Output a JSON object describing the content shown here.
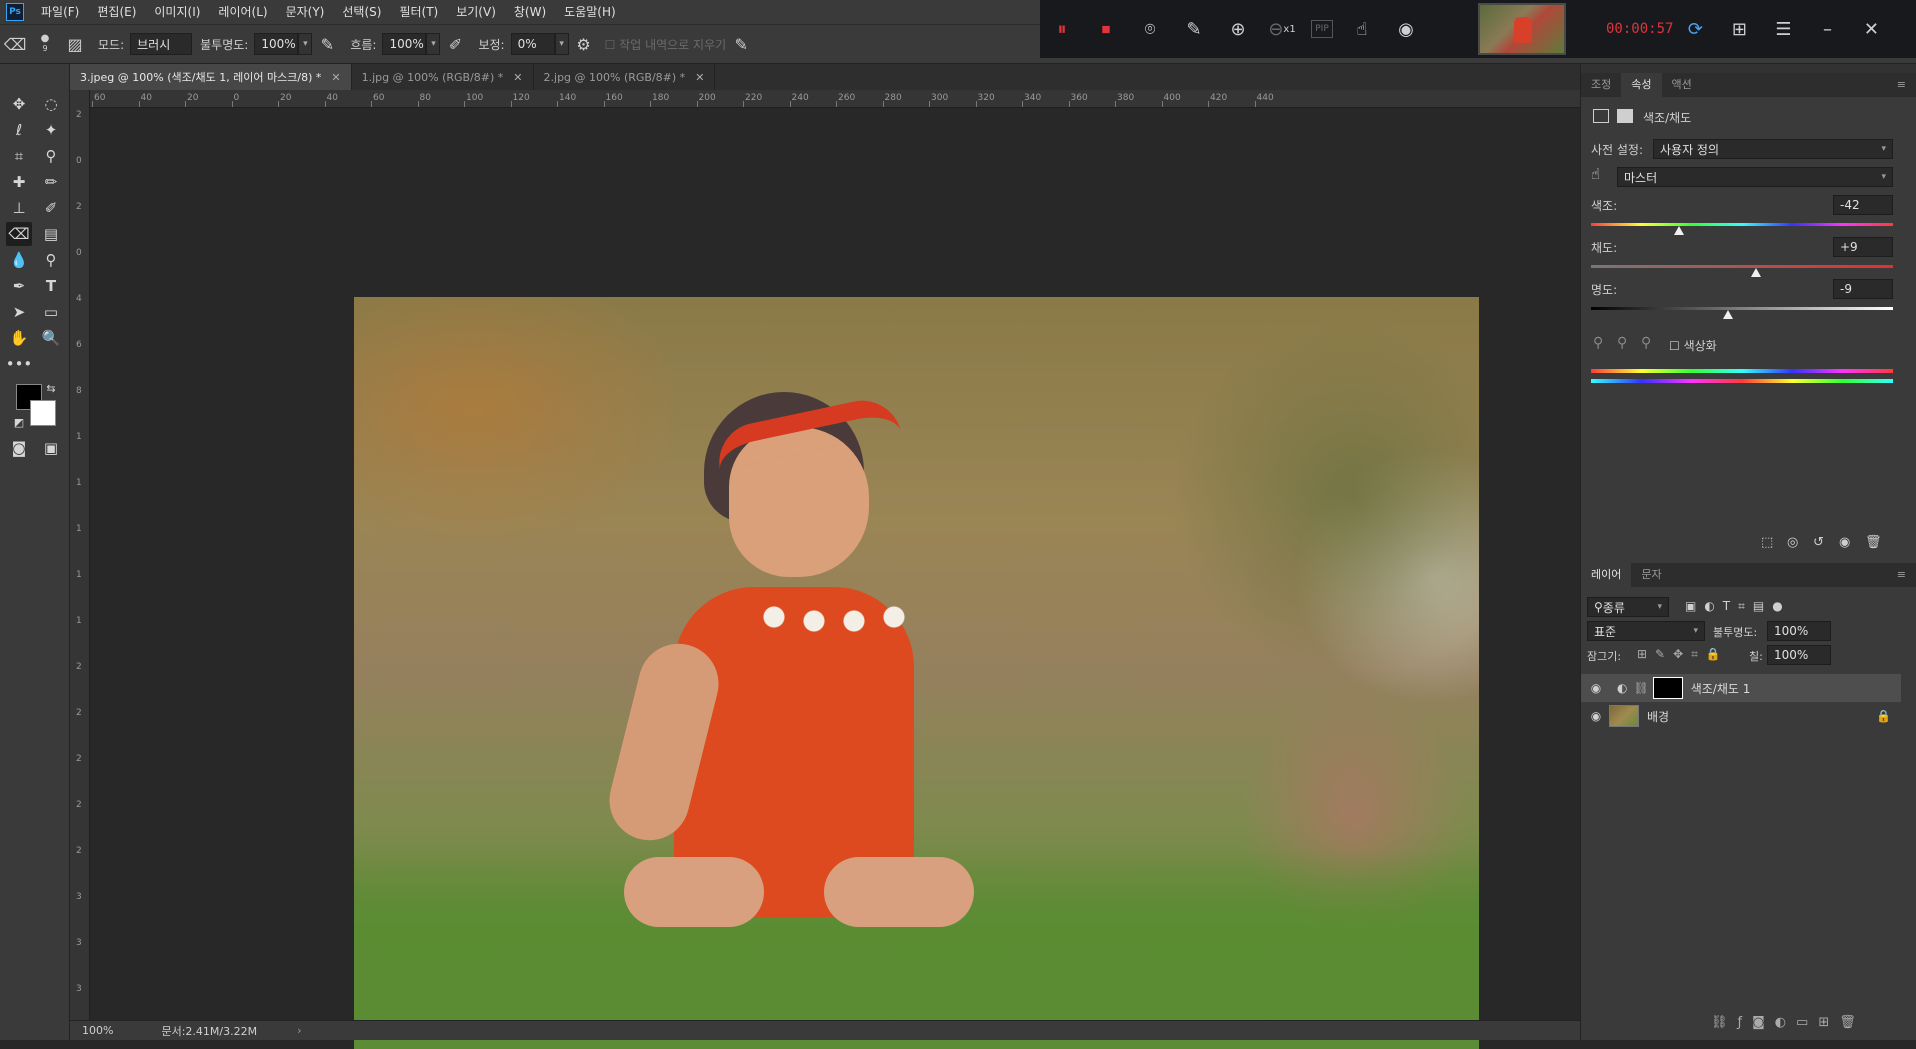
{
  "app": {
    "logo_text": "Ps",
    "menu": [
      "파일(F)",
      "편집(E)",
      "이미지(I)",
      "레이어(L)",
      "문자(Y)",
      "선택(S)",
      "필터(T)",
      "보기(V)",
      "창(W)",
      "도움말(H)"
    ]
  },
  "options": {
    "brush_size": "9",
    "mode_label": "모드:",
    "mode_value": "브러시",
    "opacity_label": "불투명도:",
    "opacity_value": "100%",
    "flow_label": "흐름:",
    "flow_value": "100%",
    "smoothing_label": "보정:",
    "smoothing_value": "0%",
    "erase_history_label": "작업 내역으로 지우기"
  },
  "recorder": {
    "zoom_factor": "x1",
    "pip_label": "PIP",
    "timer": "00:00:57"
  },
  "tabs": [
    {
      "label": "3.jpeg @ 100% (색조/채도 1, 레이어 마스크/8) *",
      "active": true
    },
    {
      "label": "1.jpg @ 100% (RGB/8#) *",
      "active": false
    },
    {
      "label": "2.jpg @ 100% (RGB/8#) *",
      "active": false
    }
  ],
  "ruler": {
    "top_ticks": [
      "60",
      "40",
      "20",
      "0",
      "20",
      "40",
      "60",
      "80",
      "100",
      "120",
      "140",
      "160",
      "180",
      "200",
      "220",
      "240",
      "260",
      "280",
      "300",
      "320",
      "340",
      "360",
      "380",
      "400",
      "420",
      "440"
    ],
    "left_ticks": [
      "2",
      "0",
      "2",
      "0",
      "4",
      "6",
      "8",
      "1",
      "1",
      "1",
      "1",
      "1",
      "2",
      "2",
      "2",
      "2",
      "2",
      "3",
      "3",
      "3"
    ]
  },
  "properties": {
    "tabs": [
      "조정",
      "속성",
      "액션"
    ],
    "active_tab": "속성",
    "header": "색조/채도",
    "preset_label": "사전 설정:",
    "preset_value": "사용자 정의",
    "channel_value": "마스터",
    "hue_label": "색조:",
    "hue_value": "-42",
    "hue_pos": 0.29,
    "saturation_label": "채도:",
    "saturation_value": "+9",
    "saturation_pos": 0.545,
    "lightness_label": "명도:",
    "lightness_value": "-9",
    "lightness_pos": 0.455,
    "colorize_label": "색상화"
  },
  "layers": {
    "tabs": [
      "레이어",
      "문자"
    ],
    "filter_label": "종류",
    "blend_mode": "표준",
    "opacity_label": "불투명도:",
    "opacity_value": "100%",
    "lock_label": "잠그기:",
    "fill_label": "칠:",
    "fill_value": "100%",
    "items": [
      {
        "name": "색조/채도 1",
        "selected": true
      },
      {
        "name": "배경",
        "selected": false
      }
    ]
  },
  "status": {
    "zoom": "100%",
    "doc": "문서:2.41M/3.22M"
  },
  "colors": {
    "accent": "#33a3f4",
    "record_red": "#e0343a",
    "dress": "#e04a22"
  }
}
